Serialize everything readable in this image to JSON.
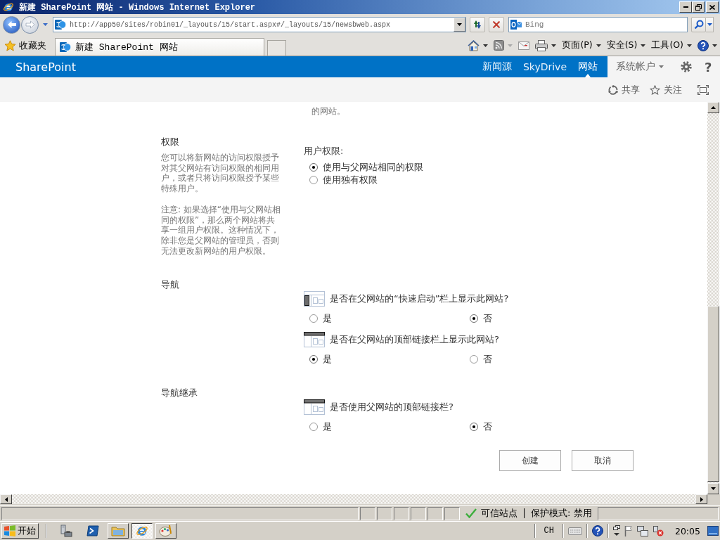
{
  "window": {
    "title": "新建 SharePoint 网站 - Windows Internet Explorer"
  },
  "address_bar": {
    "url": "http://app50/sites/robin01/_layouts/15/start.aspx#/_layouts/15/newsbweb.aspx"
  },
  "search": {
    "placeholder": "Bing"
  },
  "favorites_bar": {
    "label": "收藏夹",
    "tabs": [
      {
        "label": "新建 SharePoint 网站",
        "selected": true
      }
    ]
  },
  "command_bar": {
    "menus": [
      "页面(P)",
      "安全(S)",
      "工具(O)"
    ]
  },
  "suite_bar": {
    "brand": "SharePoint",
    "links": [
      {
        "label": "新闻源",
        "selected": false
      },
      {
        "label": "SkyDrive",
        "selected": false
      },
      {
        "label": "网站",
        "selected": true
      }
    ],
    "account": "系统帐户",
    "help": "?"
  },
  "page_actions": [
    {
      "kind": "share",
      "label": "共享"
    },
    {
      "kind": "follow",
      "label": "关注"
    }
  ],
  "form": {
    "overflow_text": "的网站。",
    "sections": [
      {
        "kind": "permissions",
        "title": "权限",
        "description": [
          "您可以将新网站的访问权限授予对其父网站有访问权限的相同用户，或者只将访问权限授予某些特殊用户。",
          "注意: 如果选择“使用与父网站相同的权限”，那么两个网站将共享一组用户权限。这种情况下，除非您是父网站的管理员，否则无法更改新网站的用户权限。"
        ],
        "field_label": "用户权限:",
        "options": [
          {
            "label": "使用与父网站相同的权限",
            "selected": true
          },
          {
            "label": "使用独有权限",
            "selected": false
          }
        ]
      },
      {
        "kind": "questions",
        "title": "导航",
        "questions": [
          {
            "kind": "quick_launch",
            "text": "是否在父网站的“快速启动”栏上显示此网站?",
            "options": [
              {
                "label": "是",
                "selected": false
              },
              {
                "label": "否",
                "selected": true
              }
            ]
          },
          {
            "kind": "top_link",
            "text": "是否在父网站的顶部链接栏上显示此网站?",
            "options": [
              {
                "label": "是",
                "selected": true
              },
              {
                "label": "否",
                "selected": false
              }
            ]
          }
        ]
      },
      {
        "kind": "questions",
        "title": "导航继承",
        "questions": [
          {
            "kind": "top_link",
            "text": "是否使用父网站的顶部链接栏?",
            "options": [
              {
                "label": "是",
                "selected": false
              },
              {
                "label": "否",
                "selected": true
              }
            ]
          }
        ]
      }
    ],
    "buttons": [
      "创建",
      "取消"
    ]
  },
  "status_bar": {
    "zone": "可信站点",
    "protected_mode": "保护模式: 禁用"
  },
  "taskbar": {
    "start": "开始",
    "tasks": [
      {
        "kind": "folder",
        "selected": false
      },
      {
        "kind": "browser",
        "selected": true
      },
      {
        "kind": "paint",
        "selected": false
      }
    ],
    "language": "CH",
    "clock": "20:05"
  }
}
